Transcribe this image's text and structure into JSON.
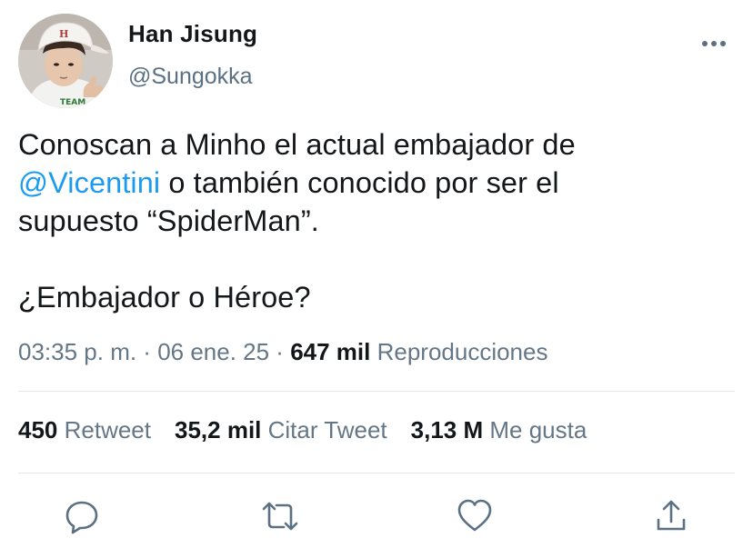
{
  "author": {
    "display_name": "Han Jisung",
    "handle": "@Sungokka",
    "cap_logo": "H"
  },
  "tweet": {
    "line1": "Conoscan a Minho el actual embajador de",
    "mention": "@Vicentini",
    "line2_rest": " o también conocido por ser el",
    "line3": "supuesto “SpiderMan”.",
    "line4": "¿Embajador o Héroe?"
  },
  "meta": {
    "time": "03:35 p. m.",
    "sep1": " · ",
    "date": "06 ene. 25",
    "sep2": " · ",
    "views_count": "647 mil",
    "views_label": " Reproducciones"
  },
  "stats": {
    "retweets": {
      "count": "450",
      "label": " Retweet"
    },
    "quotes": {
      "count": "35,2 mil",
      "label": " Citar Tweet"
    },
    "likes": {
      "count": "3,13 M",
      "label": " Me gusta"
    }
  },
  "icons": {
    "more": "more-horizontal-icon",
    "reply": "comment-bubble-icon",
    "retweet": "retweet-arrows-icon",
    "like": "heart-icon",
    "share": "share-upload-icon"
  },
  "colors": {
    "accent": "#1d9bf0",
    "text": "#14171a",
    "secondary": "#657786",
    "icon": "#5b7083",
    "divider": "#e1e8ed"
  }
}
